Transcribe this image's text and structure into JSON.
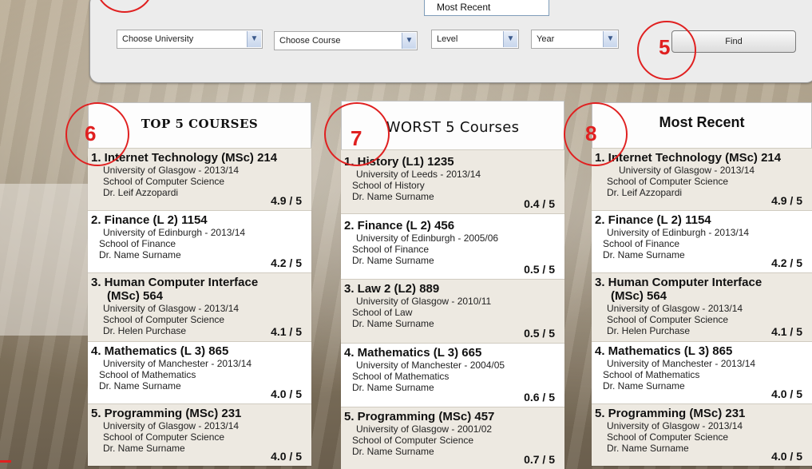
{
  "filters": {
    "university": "Choose University",
    "course": "Choose Course",
    "level": "Level",
    "year": "Year",
    "find": "Find"
  },
  "sort_popup": "Most Recent",
  "annotations": [
    "5",
    "6",
    "7",
    "8"
  ],
  "columns": [
    {
      "title": "TOP 5 COURSES",
      "courses": [
        {
          "title": "1. Internet Technology (MSc) 214",
          "uni": "University of Glasgow - 2013/14",
          "school": "School of Computer Science",
          "lecturer": "Dr. Leif Azzopardi",
          "rating": "4.9 / 5"
        },
        {
          "title": "2. Finance (L 2) 1154",
          "uni": "University of Edinburgh - 2013/14",
          "school": "School of Finance",
          "lecturer": "Dr. Name Surname",
          "rating": "4.2 / 5"
        },
        {
          "title": "3. Human Computer Interface",
          "title2": "(MSc) 564",
          "uni": "University of Glasgow - 2013/14",
          "school": "School of Computer Science",
          "lecturer": "Dr. Helen Purchase",
          "rating": "4.1 / 5"
        },
        {
          "title": "4. Mathematics (L 3) 865",
          "uni": "University of Manchester - 2013/14",
          "school": "School of Mathematics",
          "lecturer": "Dr. Name Surname",
          "rating": "4.0 / 5"
        },
        {
          "title": "5. Programming (MSc) 231",
          "uni": "University of Glasgow - 2013/14",
          "school": "School of Computer Science",
          "lecturer": "Dr. Name Surname",
          "rating": "4.0 / 5"
        }
      ]
    },
    {
      "title": "WORST 5 Courses",
      "courses": [
        {
          "title": "1. History (L1) 1235",
          "uni": "University of Leeds - 2013/14",
          "school": "School of History",
          "lecturer": "Dr. Name Surname",
          "rating": "0.4 / 5"
        },
        {
          "title": "2. Finance (L 2) 456",
          "uni": "University of Edinburgh - 2005/06",
          "school": "School of Finance",
          "lecturer": "Dr. Name Surname",
          "rating": "0.5 / 5"
        },
        {
          "title": "3. Law 2 (L2) 889",
          "uni": "University of Glasgow - 2010/11",
          "school": "School of Law",
          "lecturer": "Dr. Name Surname",
          "rating": "0.5 / 5"
        },
        {
          "title": "4. Mathematics (L 3) 665",
          "uni": "University of Manchester - 2004/05",
          "school": "School of Mathematics",
          "lecturer": "Dr. Name Surname",
          "rating": "0.6 / 5"
        },
        {
          "title": "5. Programming (MSc) 457",
          "uni": "University of Glasgow - 2001/02",
          "school": "School of Computer Science",
          "lecturer": "Dr. Name Surname",
          "rating": "0.7 / 5"
        }
      ]
    },
    {
      "title": "Most Recent",
      "courses": [
        {
          "title": "1. Internet Technology (MSc) 214",
          "uni": "University of Glasgow - 2013/14",
          "school": "School of Computer Science",
          "lecturer": "Dr. Leif Azzopardi",
          "rating": "4.9 / 5"
        },
        {
          "title": "2. Finance (L 2) 1154",
          "uni": "University of Edinburgh - 2013/14",
          "school": "School of Finance",
          "lecturer": "Dr. Name Surname",
          "rating": "4.2 / 5"
        },
        {
          "title": "3. Human Computer Interface",
          "title2": "(MSc) 564",
          "uni": "University of Glasgow - 2013/14",
          "school": "School of Computer Science",
          "lecturer": "Dr. Helen Purchase",
          "rating": "4.1 / 5"
        },
        {
          "title": "4. Mathematics (L 3) 865",
          "uni": "University of Manchester - 2013/14",
          "school": "School of Mathematics",
          "lecturer": "Dr. Name Surname",
          "rating": "4.0 / 5"
        },
        {
          "title": "5. Programming (MSc) 231",
          "uni": "University of Glasgow - 2013/14",
          "school": "School of Computer Science",
          "lecturer": "Dr. Name Surname",
          "rating": "4.0 / 5"
        }
      ]
    }
  ],
  "colors": {
    "annotation": "#e02020",
    "card_shade": "#ede9e1",
    "card_plain": "#ffffff"
  }
}
